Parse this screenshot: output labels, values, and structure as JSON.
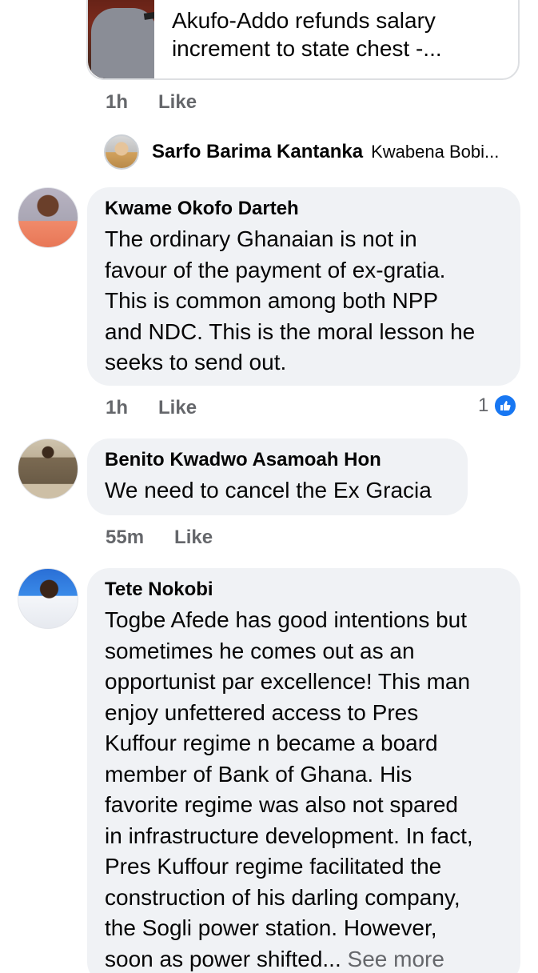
{
  "link_preview": {
    "title": "Akufo-Addo refunds salary increment to state chest -..."
  },
  "top_meta": {
    "time": "1h",
    "like_label": "Like"
  },
  "reply_summary": {
    "name": "Sarfo Barima Kantanka",
    "preview": "Kwabena Bobi..."
  },
  "comments": [
    {
      "author": "Kwame Okofo Darteh",
      "text": "The ordinary Ghanaian is not in\nfavour of the payment of ex-gratia.\nThis is common among both NPP\nand NDC. This is the moral lesson he\nseeks to send out.",
      "time": "1h",
      "like_label": "Like",
      "reaction_count": "1"
    },
    {
      "author": "Benito Kwadwo Asamoah Hon",
      "text": "We need to cancel the Ex Gracia",
      "time": "55m",
      "like_label": "Like"
    },
    {
      "author": "Tete Nokobi",
      "text": "Togbe Afede has good intentions but\nsometimes he comes out as an\nopportunist par excellence! This man\nenjoy unfettered access to Pres\nKuffour regime n became a board\nmember of Bank of Ghana. His\nfavorite regime was also not spared\nin infrastructure development. In fact,\nPres Kuffour regime facilitated the\nconstruction of his darling company,\nthe Sogli power station. However,\nsoon as power shifted...",
      "see_more": " See more"
    }
  ],
  "colors": {
    "bubble_bg": "#f0f2f5",
    "secondary_text": "#65676b",
    "like_blue": "#1877f2"
  }
}
